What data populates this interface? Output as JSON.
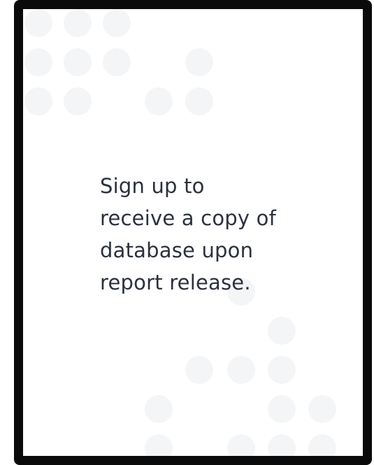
{
  "card": {
    "message": "Sign up to receive a copy of database upon report release."
  },
  "colors": {
    "frame_border": "#0a0a0a",
    "background": "#ffffff",
    "dot_pattern": "#f4f5f7",
    "text": "#2b313d"
  }
}
